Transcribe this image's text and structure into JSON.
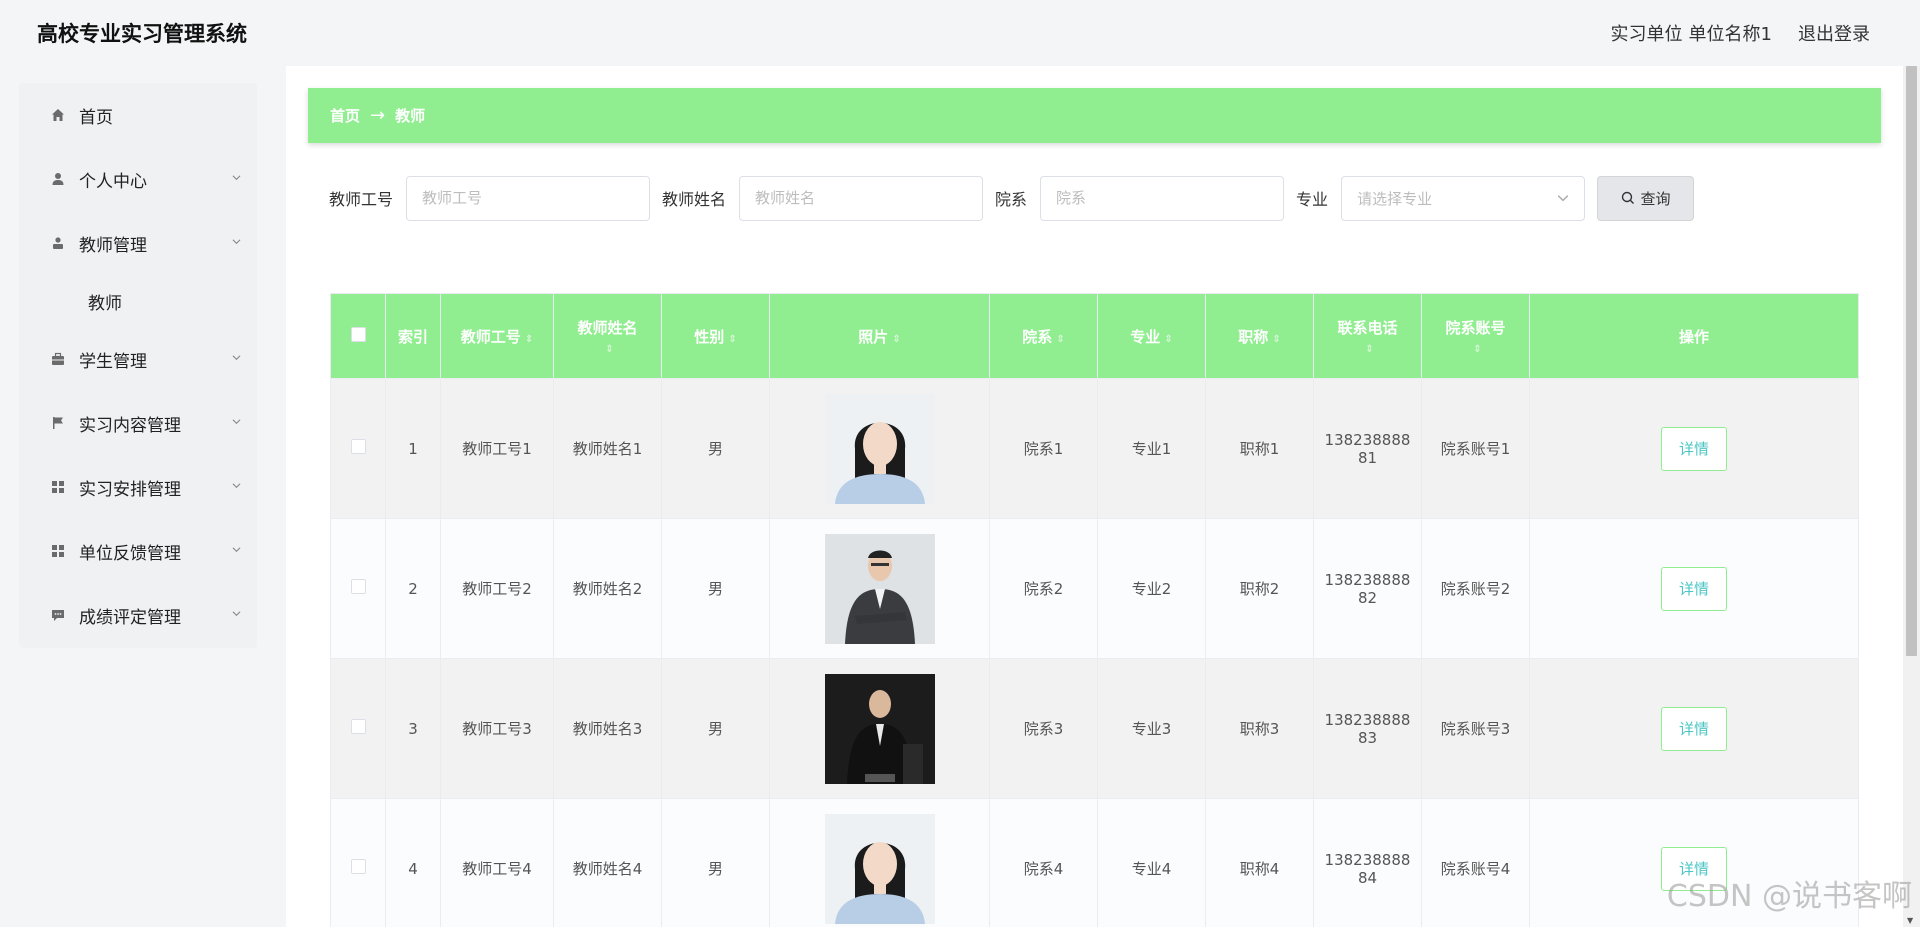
{
  "app": {
    "title": "高校专业实习管理系统"
  },
  "top_right": {
    "user_role": "实习单位",
    "user_name": "单位名称1",
    "logout": "退出登录"
  },
  "sidebar": {
    "items": [
      {
        "label": "首页",
        "icon": "home-icon"
      },
      {
        "label": "个人中心",
        "icon": "person-icon"
      },
      {
        "label": "教师管理",
        "icon": "teacher-icon"
      },
      {
        "label": "学生管理",
        "icon": "briefcase-icon"
      },
      {
        "label": "实习内容管理",
        "icon": "flag-icon"
      },
      {
        "label": "实习安排管理",
        "icon": "grid-icon"
      },
      {
        "label": "单位反馈管理",
        "icon": "grid-icon"
      },
      {
        "label": "成绩评定管理",
        "icon": "chat-icon"
      }
    ],
    "sub_item": "教师"
  },
  "breadcrumb": {
    "home": "首页",
    "arrow": "→",
    "current": "教师"
  },
  "search": {
    "teacher_no_label": "教师工号",
    "teacher_no_placeholder": "教师工号",
    "teacher_name_label": "教师姓名",
    "teacher_name_placeholder": "教师姓名",
    "dept_label": "院系",
    "dept_placeholder": "院系",
    "major_label": "专业",
    "major_placeholder": "请选择专业",
    "query_button": "查询"
  },
  "table": {
    "headers": {
      "index": "索引",
      "teacher_no": "教师工号",
      "teacher_name": "教师姓名",
      "gender": "性别",
      "photo": "照片",
      "dept": "院系",
      "major": "专业",
      "title": "职称",
      "phone": "联系电话",
      "dept_account": "院系账号",
      "actions": "操作"
    },
    "rows": [
      {
        "index": "1",
        "teacher_no": "教师工号1",
        "teacher_name": "教师姓名1",
        "gender": "男",
        "dept": "院系1",
        "major": "专业1",
        "title": "职称1",
        "phone_a": "138238888",
        "phone_b": "81",
        "dept_account": "院系账号1",
        "action": "详情"
      },
      {
        "index": "2",
        "teacher_no": "教师工号2",
        "teacher_name": "教师姓名2",
        "gender": "男",
        "dept": "院系2",
        "major": "专业2",
        "title": "职称2",
        "phone_a": "138238888",
        "phone_b": "82",
        "dept_account": "院系账号2",
        "action": "详情"
      },
      {
        "index": "3",
        "teacher_no": "教师工号3",
        "teacher_name": "教师姓名3",
        "gender": "男",
        "dept": "院系3",
        "major": "专业3",
        "title": "职称3",
        "phone_a": "138238888",
        "phone_b": "83",
        "dept_account": "院系账号3",
        "action": "详情"
      },
      {
        "index": "4",
        "teacher_no": "教师工号4",
        "teacher_name": "教师姓名4",
        "gender": "男",
        "dept": "院系4",
        "major": "专业4",
        "title": "职称4",
        "phone_a": "138238888",
        "phone_b": "84",
        "dept_account": "院系账号4",
        "action": "详情"
      }
    ]
  },
  "watermark": "CSDN @说书客啊",
  "colors": {
    "accent": "#90ee90",
    "detail_text": "#4cc6c6"
  }
}
